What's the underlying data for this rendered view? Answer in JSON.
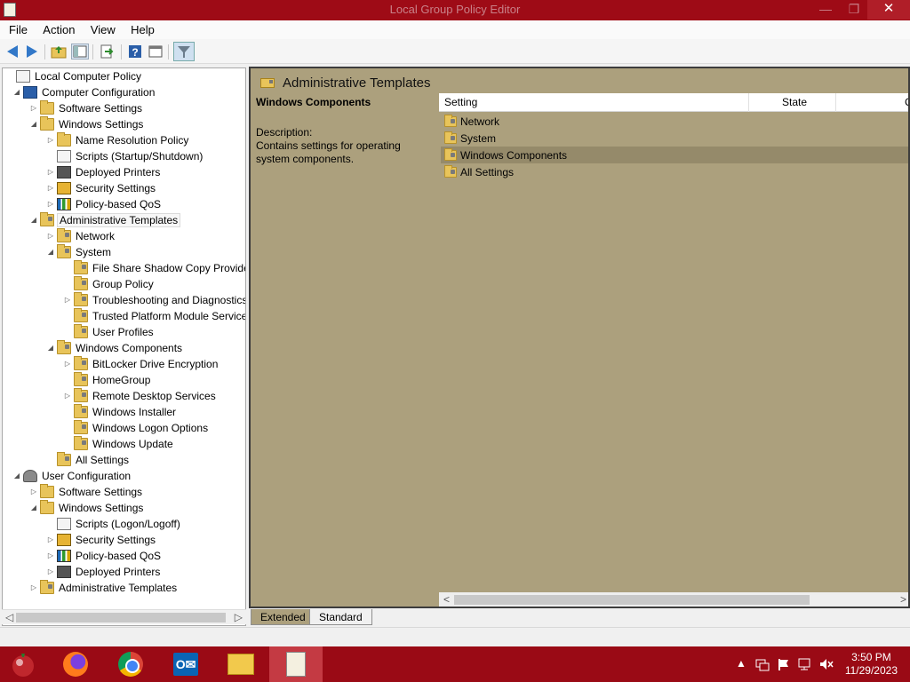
{
  "window": {
    "title": "Local Group Policy Editor",
    "minimize": "—",
    "maximize": "❐",
    "close": "✕"
  },
  "menu": [
    "File",
    "Action",
    "View",
    "Help"
  ],
  "tree": {
    "items": [
      {
        "label": "Local Computer Policy",
        "level": 0,
        "expander": "",
        "icon": "doc"
      },
      {
        "label": "Computer Configuration",
        "level": 1,
        "expander": "◢",
        "icon": "computer"
      },
      {
        "label": "Software Settings",
        "level": 2,
        "expander": "▷",
        "icon": "folder"
      },
      {
        "label": "Windows Settings",
        "level": 2,
        "expander": "◢",
        "icon": "folder"
      },
      {
        "label": "Name Resolution Policy",
        "level": 3,
        "expander": "▷",
        "icon": "folder"
      },
      {
        "label": "Scripts (Startup/Shutdown)",
        "level": 3,
        "expander": "",
        "icon": "doc"
      },
      {
        "label": "Deployed Printers",
        "level": 3,
        "expander": "▷",
        "icon": "printer"
      },
      {
        "label": "Security Settings",
        "level": 3,
        "expander": "▷",
        "icon": "lock"
      },
      {
        "label": "Policy-based QoS",
        "level": 3,
        "expander": "▷",
        "icon": "chart"
      },
      {
        "label": "Administrative Templates",
        "level": 2,
        "expander": "◢",
        "icon": "settings-folder",
        "selected": true
      },
      {
        "label": "Network",
        "level": 3,
        "expander": "▷",
        "icon": "settings-folder"
      },
      {
        "label": "System",
        "level": 3,
        "expander": "◢",
        "icon": "settings-folder"
      },
      {
        "label": "File Share Shadow Copy Provider",
        "level": 4,
        "expander": "",
        "icon": "settings-folder"
      },
      {
        "label": "Group Policy",
        "level": 4,
        "expander": "",
        "icon": "settings-folder"
      },
      {
        "label": "Troubleshooting and Diagnostics",
        "level": 4,
        "expander": "▷",
        "icon": "settings-folder"
      },
      {
        "label": "Trusted Platform Module Services",
        "level": 4,
        "expander": "",
        "icon": "settings-folder"
      },
      {
        "label": "User Profiles",
        "level": 4,
        "expander": "",
        "icon": "settings-folder"
      },
      {
        "label": "Windows Components",
        "level": 3,
        "expander": "◢",
        "icon": "settings-folder"
      },
      {
        "label": "BitLocker Drive Encryption",
        "level": 4,
        "expander": "▷",
        "icon": "settings-folder"
      },
      {
        "label": "HomeGroup",
        "level": 4,
        "expander": "",
        "icon": "settings-folder"
      },
      {
        "label": "Remote Desktop Services",
        "level": 4,
        "expander": "▷",
        "icon": "settings-folder"
      },
      {
        "label": "Windows Installer",
        "level": 4,
        "expander": "",
        "icon": "settings-folder"
      },
      {
        "label": "Windows Logon Options",
        "level": 4,
        "expander": "",
        "icon": "settings-folder"
      },
      {
        "label": "Windows Update",
        "level": 4,
        "expander": "",
        "icon": "settings-folder"
      },
      {
        "label": "All Settings",
        "level": 3,
        "expander": "",
        "icon": "settings-folder"
      },
      {
        "label": "User Configuration",
        "level": 1,
        "expander": "◢",
        "icon": "user"
      },
      {
        "label": "Software Settings",
        "level": 2,
        "expander": "▷",
        "icon": "folder"
      },
      {
        "label": "Windows Settings",
        "level": 2,
        "expander": "◢",
        "icon": "folder"
      },
      {
        "label": "Scripts (Logon/Logoff)",
        "level": 3,
        "expander": "",
        "icon": "doc"
      },
      {
        "label": "Security Settings",
        "level": 3,
        "expander": "▷",
        "icon": "lock"
      },
      {
        "label": "Policy-based QoS",
        "level": 3,
        "expander": "▷",
        "icon": "chart"
      },
      {
        "label": "Deployed Printers",
        "level": 3,
        "expander": "▷",
        "icon": "printer"
      },
      {
        "label": "Administrative Templates",
        "level": 2,
        "expander": "▷",
        "icon": "settings-folder"
      }
    ]
  },
  "main": {
    "title": "Administrative Templates",
    "selected_name": "Windows Components",
    "description_label": "Description:",
    "description": "Contains settings for operating system components.",
    "columns": [
      "Setting",
      "State",
      "C"
    ],
    "rows": [
      {
        "label": "Network",
        "selected": false
      },
      {
        "label": "System",
        "selected": false
      },
      {
        "label": "Windows Components",
        "selected": true
      },
      {
        "label": "All Settings",
        "selected": false
      }
    ],
    "tabs": [
      "Extended",
      "Standard"
    ]
  },
  "taskbar": {
    "clock_time": "3:50 PM",
    "clock_date": "11/29/2023",
    "tray_chevron": "▲"
  },
  "colors": {
    "titlebar": "#9e0b16",
    "main_background": "#aca07d",
    "taskbar": "#9a0a15"
  }
}
